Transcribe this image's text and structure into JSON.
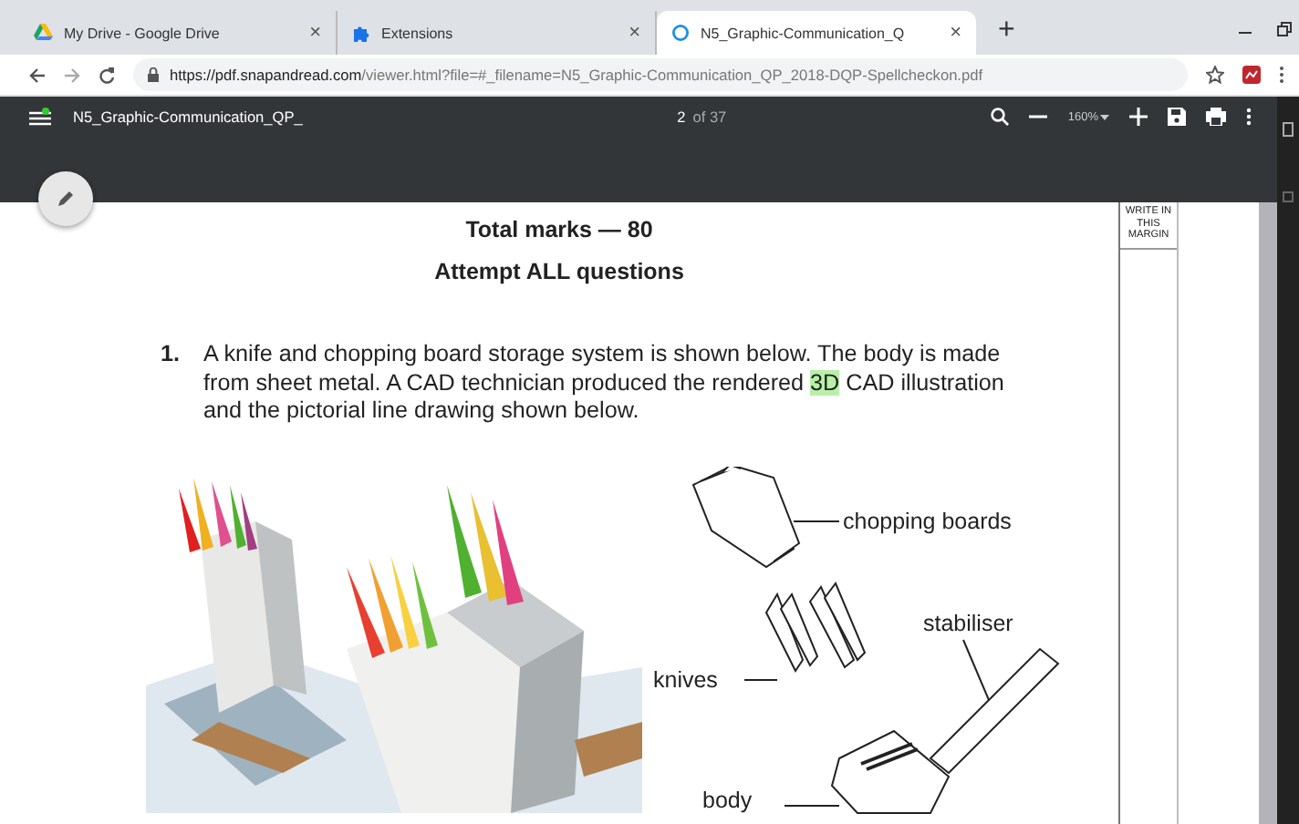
{
  "tabs": [
    {
      "title": "My Drive - Google Drive",
      "close": "×",
      "selected": false
    },
    {
      "title": "Extensions",
      "close": "×",
      "selected": false
    },
    {
      "title": "N5_Graphic-Communication_Q",
      "close": "×",
      "selected": true
    }
  ],
  "new_tab": "+",
  "address_bar": {
    "url_host": "https://pdf.snapandread.com",
    "url_path": "/viewer.html?file=#_filename=N5_Graphic-Communication_QP_2018-DQP-Spellcheckon.pdf"
  },
  "pdf_toolbar": {
    "title": "N5_Graphic-Communication_QP_",
    "page": "2",
    "page_total": "of 37",
    "zoom": "160%"
  },
  "page": {
    "heading": "Total marks — 80",
    "subheading": "Attempt ALL questions",
    "margin_header": "WRITE IN THIS MARGIN",
    "question": {
      "number": "1.",
      "text_before": "A knife and chopping board storage system is shown below. The body is made from sheet metal. A CAD technician produced the rendered ",
      "highlighted": "3D",
      "text_after": " CAD illustration and the pictorial line drawing shown below."
    },
    "figure_labels": [
      "chopping boards",
      "stabiliser",
      "knives",
      "body"
    ]
  }
}
